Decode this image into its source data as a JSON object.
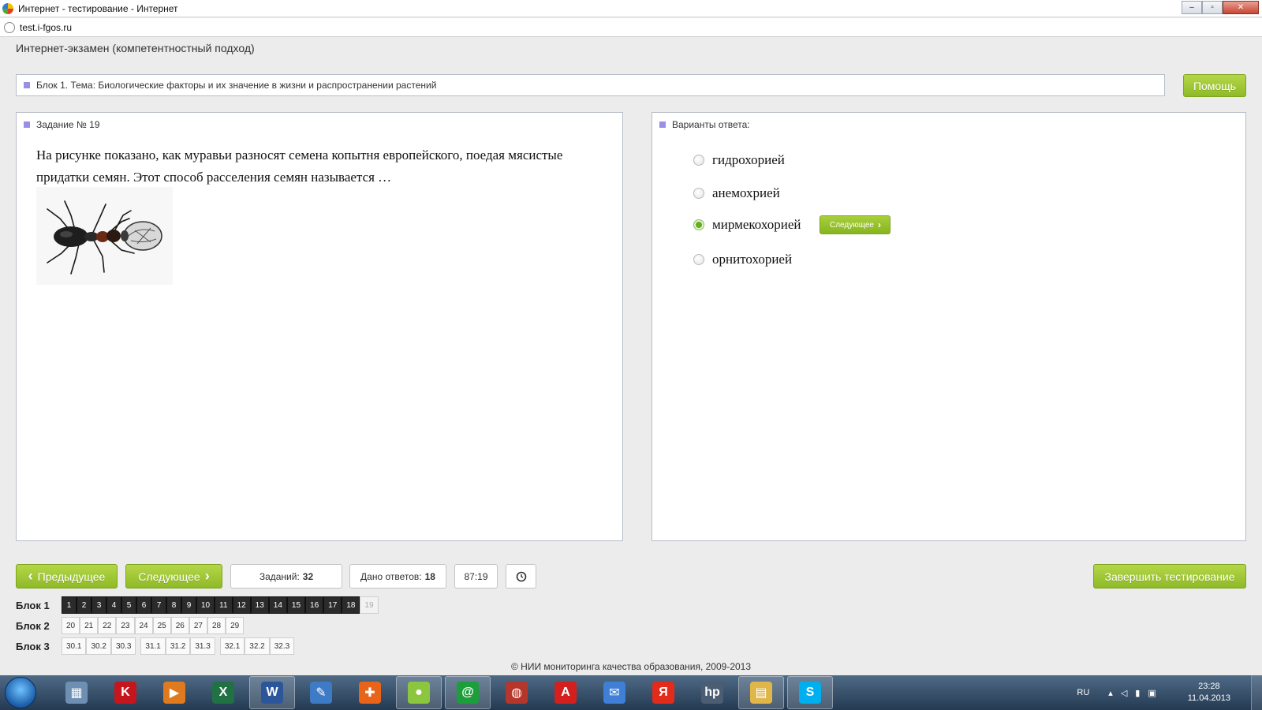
{
  "window": {
    "title": "Интернет - тестирование - Интернет",
    "url": "test.i-fgos.ru",
    "controls": {
      "minimize": "–",
      "maximize": "▫",
      "close": "✕"
    }
  },
  "header": {
    "title": "Интернет-экзамен (компетентностный подход)"
  },
  "topic": {
    "text": "Блок 1. Тема: Биологические факторы и их значение в жизни и распространении растений"
  },
  "help_label": "Помощь",
  "question": {
    "label": "Задание № 19",
    "text": "На рисунке показано, как муравьи разносят семена копытня европейского, поедая мясистые придатки семян. Этот способ расселения семян называется …",
    "image": "ant-carrying-seed"
  },
  "answers": {
    "label": "Варианты ответа:",
    "options": [
      "гидрохорией",
      "анемохрией",
      "мирмекохорией",
      "орнитохорией"
    ],
    "selected_index": 2,
    "inline_next_label": "Следующее"
  },
  "navigation": {
    "prev_label": "Предыдущее",
    "next_label": "Следующее",
    "finish_label": "Завершить тестирование",
    "tasks_label": "Заданий:",
    "tasks_count": "32",
    "answered_label": "Дано ответов:",
    "answered_count": "18",
    "timer": "87:19"
  },
  "blocks": [
    {
      "label": "Блок 1",
      "groups": [
        [
          "1",
          "2",
          "3",
          "4",
          "5",
          "6",
          "7",
          "8",
          "9",
          "10",
          "11",
          "12",
          "13",
          "14",
          "15",
          "16",
          "17",
          "18",
          "19"
        ]
      ]
    },
    {
      "label": "Блок 2",
      "groups": [
        [
          "20",
          "21",
          "22",
          "23",
          "24",
          "25",
          "26",
          "27",
          "28",
          "29"
        ]
      ]
    },
    {
      "label": "Блок 3",
      "groups": [
        [
          "30.1",
          "30.2",
          "30.3"
        ],
        [
          "31.1",
          "31.2",
          "31.3"
        ],
        [
          "32.1",
          "32.2",
          "32.3"
        ]
      ]
    }
  ],
  "answered_tasks": [
    "1",
    "2",
    "3",
    "4",
    "5",
    "6",
    "7",
    "8",
    "9",
    "10",
    "11",
    "12",
    "13",
    "14",
    "15",
    "16",
    "17",
    "18"
  ],
  "current_task": "19",
  "footer": {
    "text": "© НИИ мониторинга качества образования, 2009-2013"
  },
  "taskbar": {
    "apps": [
      {
        "name": "calculator-icon",
        "glyph": "▦",
        "color": "#6d8fb4"
      },
      {
        "name": "kaspersky-icon",
        "glyph": "K",
        "color": "#c4161c"
      },
      {
        "name": "media-player-icon",
        "glyph": "▶",
        "color": "#e07a1f"
      },
      {
        "name": "excel-icon",
        "glyph": "X",
        "color": "#207245"
      },
      {
        "name": "word-icon",
        "glyph": "W",
        "color": "#2b579a",
        "active": true
      },
      {
        "name": "notes-icon",
        "glyph": "✎",
        "color": "#3d7bc7"
      },
      {
        "name": "puzzle-app-icon",
        "glyph": "✚",
        "color": "#e8641b"
      },
      {
        "name": "browser-icon",
        "glyph": "●",
        "color": "#8cc63f",
        "active": true
      },
      {
        "name": "mail-agent-icon",
        "glyph": "@",
        "color": "#1c9e3a",
        "active": true
      },
      {
        "name": "globe-app-icon",
        "glyph": "◍",
        "color": "#b5372b"
      },
      {
        "name": "pdf-reader-icon",
        "glyph": "A",
        "color": "#d41f1f"
      },
      {
        "name": "mail-icon",
        "glyph": "✉",
        "color": "#3f7fd6"
      },
      {
        "name": "yandex-icon",
        "glyph": "Я",
        "color": "#e32b1c"
      },
      {
        "name": "hp-icon",
        "glyph": "hp",
        "color": "#4b5d73"
      },
      {
        "name": "explorer-icon",
        "glyph": "▤",
        "color": "#e0b64a",
        "active": true
      },
      {
        "name": "skype-icon",
        "glyph": "S",
        "color": "#00aff0",
        "active": true
      }
    ],
    "language": "RU",
    "time": "23:28",
    "date": "11.04.2013"
  }
}
